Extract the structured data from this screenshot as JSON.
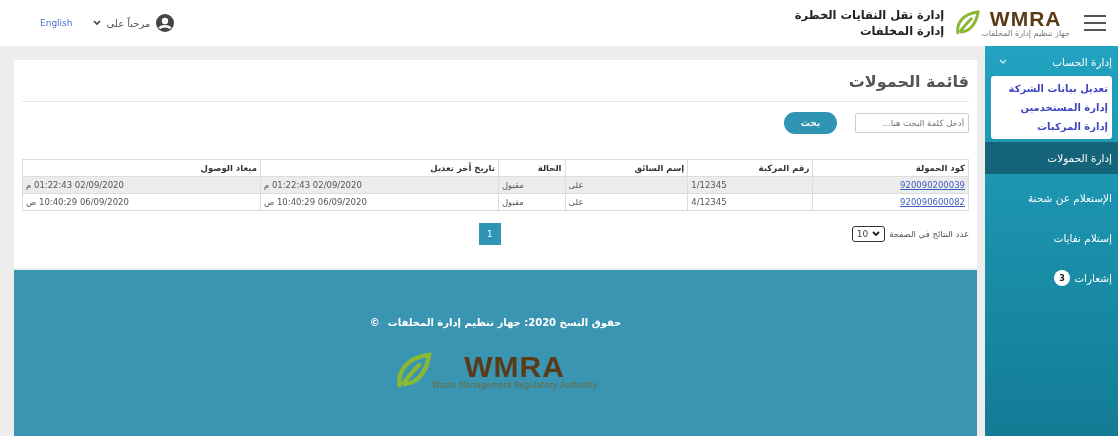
{
  "header": {
    "logo_text": "WMRA",
    "logo_subtitle": "جهاز تنظيم إدارة المخلفات",
    "title_line1": "إدارة نقل النفايات الخطرة",
    "title_line2": "إدارة المخلفات",
    "greeting": "مرحباً على",
    "language": "English"
  },
  "sidebar": {
    "account": {
      "label": "إدارة الحساب",
      "expanded": true,
      "children": [
        {
          "label": "تعديل بيانات الشركة"
        },
        {
          "label": "إدارة المستخدمين"
        },
        {
          "label": "إدارة المركبات"
        }
      ]
    },
    "items": [
      {
        "label": "إدارة الحمولات",
        "selected": true
      },
      {
        "label": "الإستعلام عن شحنة",
        "selected": false
      },
      {
        "label": "إستلام نفايات",
        "selected": false
      },
      {
        "label": "إشعارات",
        "selected": false,
        "badge": "3"
      }
    ]
  },
  "page": {
    "title": "قائمة الحمولات",
    "search": {
      "placeholder": "أدخل كلمة البحث هنا...",
      "button": "بحث"
    }
  },
  "table": {
    "columns": [
      "كود الحمولة",
      "رقم المركبة",
      "إسم السائق",
      "الحالة",
      "تاريخ أخر تعديل",
      "ميعاد الوصول"
    ],
    "rows": [
      {
        "selected": true,
        "cells": [
          "920090200039",
          "1/12345",
          "على",
          "مقبول",
          "02/09/2020 01:22:43 م",
          "02/09/2020 01:22:43 م"
        ]
      },
      {
        "selected": false,
        "cells": [
          "920090600082",
          "4/12345",
          "على",
          "مقبول",
          "06/09/2020 10:40:29 ص",
          "06/09/2020 10:40:29 ص"
        ]
      }
    ]
  },
  "pagination": {
    "page_size_label": "عدد النتائج في الصفحة",
    "page_size": "10",
    "pages": [
      {
        "label": "1",
        "selected": true
      }
    ]
  },
  "footer": {
    "copyright": "حقوق النسخ 2020: جهاز تنظيم إدارة المخلفات",
    "copyright_mark": "©",
    "logo_text": "WMRA",
    "logo_subtitle": "Waste Management Regulatory Authority"
  }
}
